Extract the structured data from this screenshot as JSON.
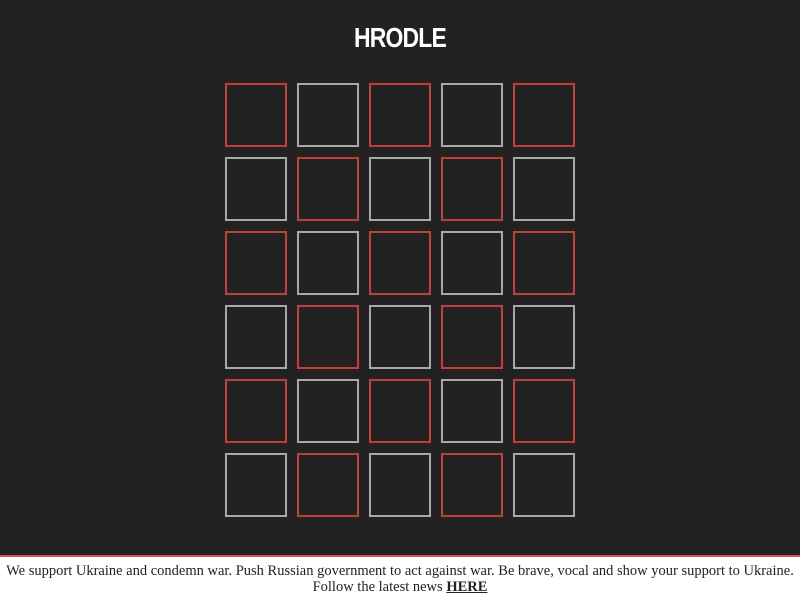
{
  "app": {
    "title": "HRODLE"
  },
  "board": {
    "rows": 6,
    "columns": 5,
    "tiles": [
      [
        "red",
        "gray",
        "red",
        "gray",
        "red"
      ],
      [
        "gray",
        "red",
        "gray",
        "red",
        "gray"
      ],
      [
        "red",
        "gray",
        "red",
        "gray",
        "red"
      ],
      [
        "gray",
        "red",
        "gray",
        "red",
        "gray"
      ],
      [
        "red",
        "gray",
        "red",
        "gray",
        "red"
      ],
      [
        "gray",
        "red",
        "gray",
        "red",
        "gray"
      ]
    ]
  },
  "banner": {
    "line1": "We support Ukraine and condemn war. Push Russian government to act against war. Be brave, vocal and show your support to Ukraine.",
    "line2_prefix": "Follow the latest news ",
    "link_label": "HERE"
  },
  "colors": {
    "background": "#222222",
    "tile_border_gray": "#a8a8a8",
    "tile_border_red": "#c0413a",
    "banner_border": "#d9534f"
  }
}
